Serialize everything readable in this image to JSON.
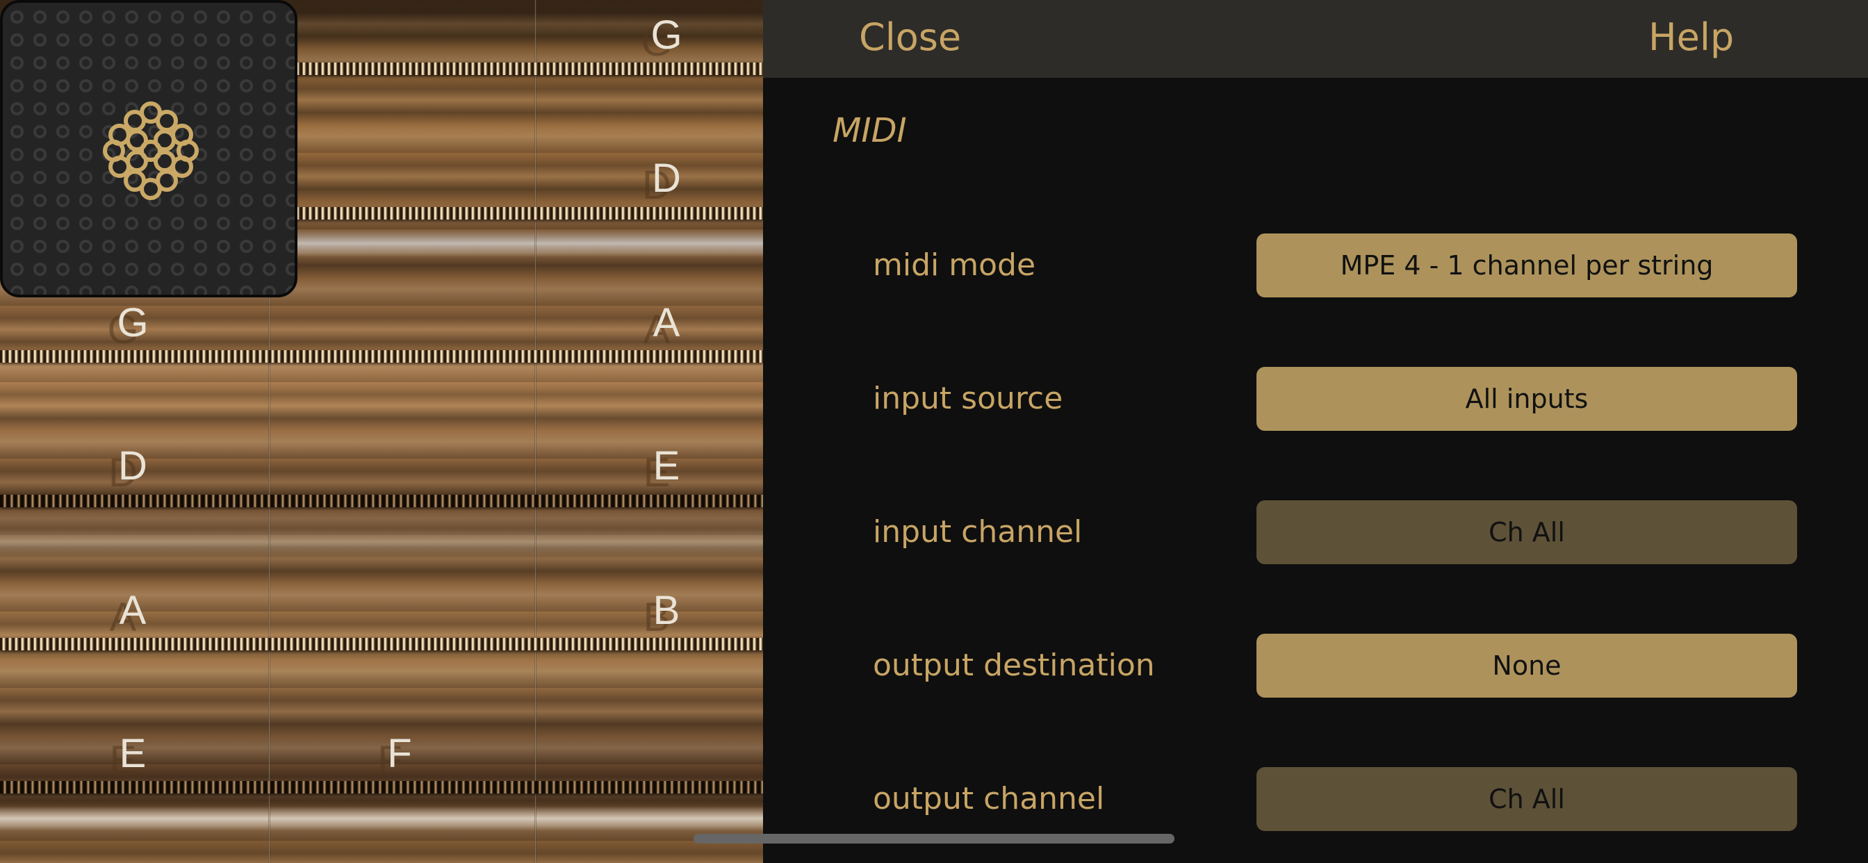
{
  "fretboard": {
    "notes": [
      {
        "label": "G"
      },
      {
        "label": "D"
      },
      {
        "label": "G"
      },
      {
        "label": "A"
      },
      {
        "label": "D"
      },
      {
        "label": "E"
      },
      {
        "label": "A"
      },
      {
        "label": "B"
      },
      {
        "label": "E"
      },
      {
        "label": "F"
      }
    ]
  },
  "header": {
    "close_label": "Close",
    "help_label": "Help"
  },
  "section": {
    "title": "MIDI"
  },
  "settings": [
    {
      "label": "midi mode",
      "value": "MPE 4 - 1 channel per string",
      "state": "active"
    },
    {
      "label": "input source",
      "value": "All inputs",
      "state": "active"
    },
    {
      "label": "input channel",
      "value": "Ch All",
      "state": "inactive"
    },
    {
      "label": "output destination",
      "value": "None",
      "state": "active"
    },
    {
      "label": "output channel",
      "value": "Ch All",
      "state": "inactive"
    }
  ],
  "colors": {
    "accent_text": "#c8a565",
    "button_active": "#ad935b",
    "button_inactive": "#5d5137",
    "topbar": "#2d2c28",
    "panel": "#0f0f0f"
  },
  "icons": {
    "logo": "ornament-logo-icon"
  }
}
